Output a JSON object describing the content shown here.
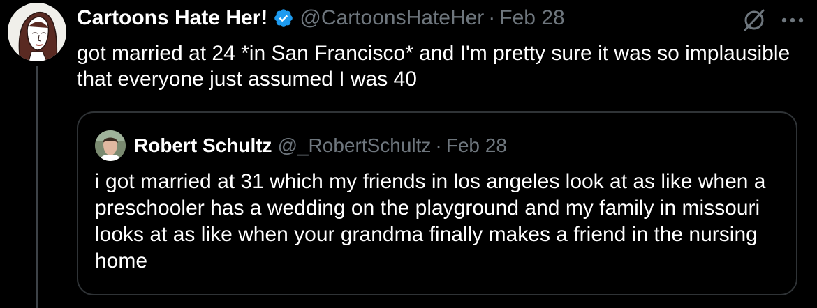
{
  "tweet": {
    "author_name": "Cartoons Hate Her!",
    "handle": "@CartoonsHateHer",
    "separator": "·",
    "date": "Feb 28",
    "text": "got married at 24 *in San Francisco* and I'm pretty sure it was so implausible that everyone just assumed I was 40",
    "avatar_icon": "illustrated-woman-portrait",
    "verified_icon": "verified-badge-icon",
    "actions": {
      "tweak_icon": "slashed-circle-icon",
      "more_icon": "more-dots-icon"
    }
  },
  "quote": {
    "author_name": "Robert Schultz",
    "handle": "@_RobertSchultz",
    "separator": "·",
    "date": "Feb 28",
    "text": "i got married at 31 which my friends in los angeles look at as like when a preschooler has a wedding on the playground and my family in missouri looks at as like when your grandma finally makes a friend in the nursing home",
    "avatar_icon": "photo-avatar"
  },
  "colors": {
    "background": "#000000",
    "text": "#ffffff",
    "muted": "#6e767d",
    "verified": "#1d9bf0",
    "border": "#2f3336",
    "thread_line": "#3d4247"
  }
}
